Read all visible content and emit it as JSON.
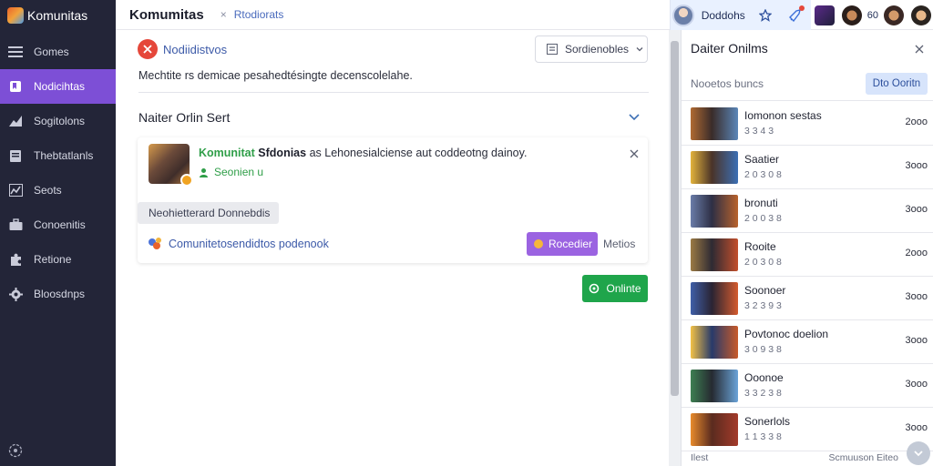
{
  "app": {
    "name": "Komunitas"
  },
  "sidebar": {
    "items": [
      {
        "label": "Gomes",
        "icon": "menu-icon",
        "active": false
      },
      {
        "label": "Nodicihtas",
        "icon": "bookmark-icon",
        "active": true
      },
      {
        "label": "Sogitolons",
        "icon": "chart-icon",
        "active": false
      },
      {
        "label": "Thebtatlanls",
        "icon": "document-icon",
        "active": false
      },
      {
        "label": "Seots",
        "icon": "stats-icon",
        "active": false
      },
      {
        "label": "Conoenitis",
        "icon": "briefcase-icon",
        "active": false
      },
      {
        "label": "Retione",
        "icon": "puzzle-icon",
        "active": false
      },
      {
        "label": "Bloosdnps",
        "icon": "gear-icon",
        "active": false
      }
    ],
    "bottom_icon": "settings-icon"
  },
  "topbar": {
    "title": "Komumitas",
    "separator": "×",
    "breadcrumb": "Rtodiorats",
    "user_name": "Doddohs",
    "count_label": "60"
  },
  "main": {
    "notice_title": "Nodiidistvos",
    "settings_button": "Sordienobles",
    "description": "Mechtite rs demicae pesahedtésingte decenscolelahe.",
    "section_title": "Naiter Orlin Sert",
    "card": {
      "highlight": "Komunitat",
      "bold": "Sfdonias",
      "text": "as Lehonesialciense aut coddeotng dainoy.",
      "status": "Seonien u",
      "tag_button": "Neohietterard Donnebdis",
      "footer_link": "Comunitetosendidtos podenook",
      "primary_button": "Rocedier",
      "more_link": "Metios"
    },
    "online_button": "Onlinte"
  },
  "right_panel": {
    "title": "Daiter Onilms",
    "search_placeholder": "Nooetos buncs",
    "search_button": "Dto Ooritn",
    "friends": [
      {
        "name": "Iomonon sestas",
        "meta": "3 3 4 3",
        "count": "2ooo",
        "colors": [
          "#b06a32",
          "#3a2c2a",
          "#5a86b8"
        ]
      },
      {
        "name": "Saatier",
        "meta": "2 0 3 0 8",
        "count": "3ooo",
        "colors": [
          "#e3b33c",
          "#4a3328",
          "#3c6fb4"
        ]
      },
      {
        "name": "bronuti",
        "meta": "2 0 0 3 8",
        "count": "3ooo",
        "colors": [
          "#6a7ca8",
          "#2e2f45",
          "#b8622c"
        ]
      },
      {
        "name": "Rooite",
        "meta": "2 0 3 0 8",
        "count": "2ooo",
        "colors": [
          "#9b7a44",
          "#2e2a33",
          "#c34f2c"
        ]
      },
      {
        "name": "Soonoer",
        "meta": "3 2 3 9 3",
        "count": "3ooo",
        "colors": [
          "#3f5fa8",
          "#2a2433",
          "#d45b2e"
        ]
      },
      {
        "name": "Povtonoc doelion",
        "meta": "3 0 9 3 8",
        "count": "3ooo",
        "colors": [
          "#f3c246",
          "#283a6a",
          "#c85a2a"
        ]
      },
      {
        "name": "Ooonoe",
        "meta": "3 3 2 3 8",
        "count": "3ooo",
        "colors": [
          "#3d7f52",
          "#262a31",
          "#6aa3d8"
        ]
      },
      {
        "name": "Sonerlols",
        "meta": "1 1 3 3 8",
        "count": "3ooo",
        "colors": [
          "#e88b2c",
          "#5a2b1f",
          "#a33a2a"
        ]
      }
    ],
    "footer_left": "Ilest",
    "footer_right": "Scmuuson Eiteo"
  },
  "colors": {
    "accent": "#7d4fd6",
    "sidebar_bg": "#232538",
    "success": "#1fa54b",
    "danger": "#e5473a",
    "link": "#3c5aa8"
  }
}
